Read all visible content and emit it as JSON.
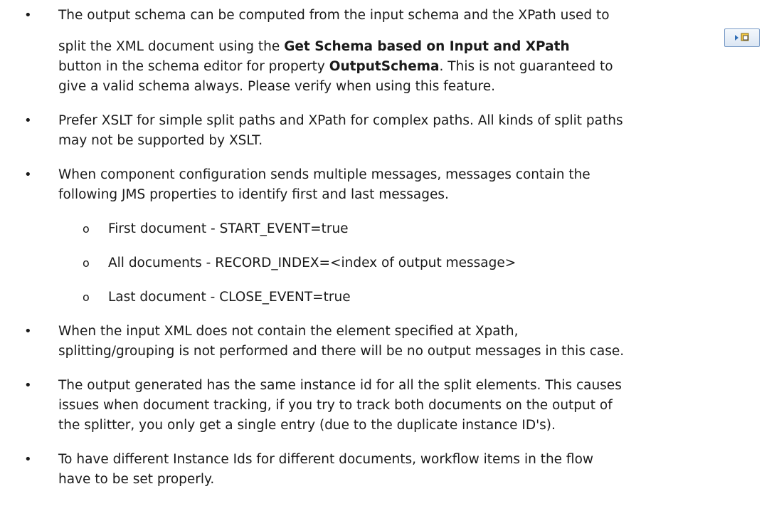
{
  "bullets": [
    {
      "line1": "The output schema can be computed from the input schema and the XPath used to",
      "line2_pre": "split the XML document using the ",
      "line2_bold": "Get Schema based on Input and XPath",
      "line3_pre": "button in the schema editor for property ",
      "line3_bold": "OutputSchema",
      "line3_post": ". This is not guaranteed to",
      "line4": "give a valid schema always. Please verify when using this feature."
    },
    {
      "line1": "Prefer XSLT for simple split paths and XPath for complex paths. All kinds of split paths",
      "line2": "may not be supported by XSLT."
    },
    {
      "line1": "When component configuration sends multiple messages, messages contain the",
      "line2": "following JMS properties to identify first and last messages."
    },
    {
      "line1": "When the input XML does not contain the element specified at Xpath,",
      "line2": "splitting/grouping is not performed and there will be no output messages in this case."
    },
    {
      "line1": "The output generated has the same instance id for all the split elements. This causes",
      "line2": "issues when document tracking, if you try to track both documents on the output of",
      "line3": "the splitter, you only get a single entry (due to the duplicate instance ID's)."
    },
    {
      "line1": "To have different Instance Ids for different documents, workflow items in the flow",
      "line2": "have to be set properly."
    }
  ],
  "sub_items": [
    "First document -  START_EVENT=true",
    "All documents -  RECORD_INDEX=<index of output message>",
    "Last document -  CLOSE_EVENT=true"
  ],
  "bullet_glyph": "•",
  "sub_bullet_glyph": "o",
  "get_schema_button": {
    "icon": "play-schema-icon",
    "border_color": "#7a9cc7"
  }
}
